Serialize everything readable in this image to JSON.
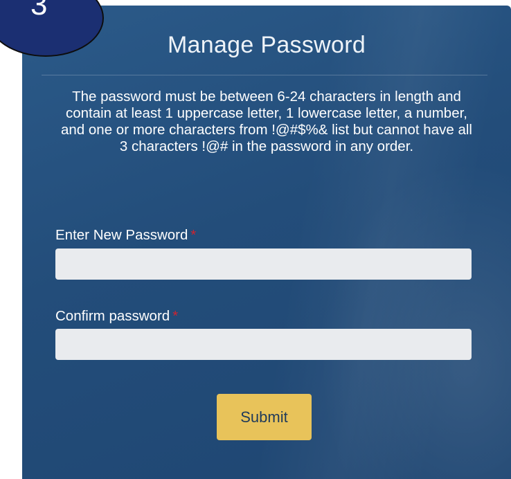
{
  "step_badge": {
    "number": "3",
    "color": "#1b2f72"
  },
  "panel": {
    "title": "Manage Password",
    "background_color": "#234d7a",
    "requirements": "The password must be between 6-24 characters in length and contain at least 1 uppercase letter, 1 lowercase letter, a number, and one or more characters from !@#$%& list but cannot have all 3 characters !@# in the password in any order."
  },
  "form": {
    "new_password": {
      "label": "Enter New Password",
      "required_marker": "*",
      "value": "",
      "placeholder": ""
    },
    "confirm_password": {
      "label": "Confirm password",
      "required_marker": "*",
      "value": "",
      "placeholder": ""
    },
    "submit_label": "Submit",
    "submit_color": "#e8c35a",
    "required_color": "#d0232f"
  }
}
